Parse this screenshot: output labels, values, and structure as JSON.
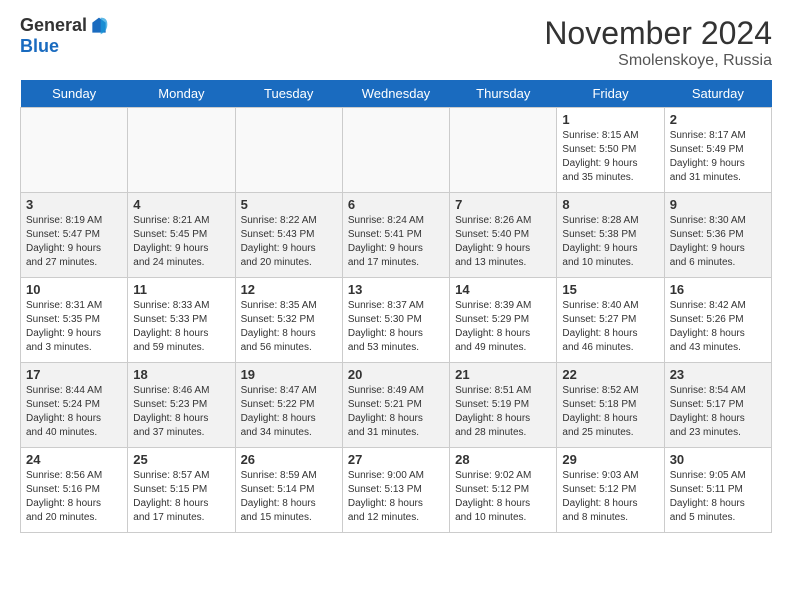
{
  "logo": {
    "general": "General",
    "blue": "Blue"
  },
  "title": "November 2024",
  "location": "Smolenskoye, Russia",
  "days_of_week": [
    "Sunday",
    "Monday",
    "Tuesday",
    "Wednesday",
    "Thursday",
    "Friday",
    "Saturday"
  ],
  "weeks": [
    [
      {
        "day": "",
        "info": ""
      },
      {
        "day": "",
        "info": ""
      },
      {
        "day": "",
        "info": ""
      },
      {
        "day": "",
        "info": ""
      },
      {
        "day": "",
        "info": ""
      },
      {
        "day": "1",
        "info": "Sunrise: 8:15 AM\nSunset: 5:50 PM\nDaylight: 9 hours\nand 35 minutes."
      },
      {
        "day": "2",
        "info": "Sunrise: 8:17 AM\nSunset: 5:49 PM\nDaylight: 9 hours\nand 31 minutes."
      }
    ],
    [
      {
        "day": "3",
        "info": "Sunrise: 8:19 AM\nSunset: 5:47 PM\nDaylight: 9 hours\nand 27 minutes."
      },
      {
        "day": "4",
        "info": "Sunrise: 8:21 AM\nSunset: 5:45 PM\nDaylight: 9 hours\nand 24 minutes."
      },
      {
        "day": "5",
        "info": "Sunrise: 8:22 AM\nSunset: 5:43 PM\nDaylight: 9 hours\nand 20 minutes."
      },
      {
        "day": "6",
        "info": "Sunrise: 8:24 AM\nSunset: 5:41 PM\nDaylight: 9 hours\nand 17 minutes."
      },
      {
        "day": "7",
        "info": "Sunrise: 8:26 AM\nSunset: 5:40 PM\nDaylight: 9 hours\nand 13 minutes."
      },
      {
        "day": "8",
        "info": "Sunrise: 8:28 AM\nSunset: 5:38 PM\nDaylight: 9 hours\nand 10 minutes."
      },
      {
        "day": "9",
        "info": "Sunrise: 8:30 AM\nSunset: 5:36 PM\nDaylight: 9 hours\nand 6 minutes."
      }
    ],
    [
      {
        "day": "10",
        "info": "Sunrise: 8:31 AM\nSunset: 5:35 PM\nDaylight: 9 hours\nand 3 minutes."
      },
      {
        "day": "11",
        "info": "Sunrise: 8:33 AM\nSunset: 5:33 PM\nDaylight: 8 hours\nand 59 minutes."
      },
      {
        "day": "12",
        "info": "Sunrise: 8:35 AM\nSunset: 5:32 PM\nDaylight: 8 hours\nand 56 minutes."
      },
      {
        "day": "13",
        "info": "Sunrise: 8:37 AM\nSunset: 5:30 PM\nDaylight: 8 hours\nand 53 minutes."
      },
      {
        "day": "14",
        "info": "Sunrise: 8:39 AM\nSunset: 5:29 PM\nDaylight: 8 hours\nand 49 minutes."
      },
      {
        "day": "15",
        "info": "Sunrise: 8:40 AM\nSunset: 5:27 PM\nDaylight: 8 hours\nand 46 minutes."
      },
      {
        "day": "16",
        "info": "Sunrise: 8:42 AM\nSunset: 5:26 PM\nDaylight: 8 hours\nand 43 minutes."
      }
    ],
    [
      {
        "day": "17",
        "info": "Sunrise: 8:44 AM\nSunset: 5:24 PM\nDaylight: 8 hours\nand 40 minutes."
      },
      {
        "day": "18",
        "info": "Sunrise: 8:46 AM\nSunset: 5:23 PM\nDaylight: 8 hours\nand 37 minutes."
      },
      {
        "day": "19",
        "info": "Sunrise: 8:47 AM\nSunset: 5:22 PM\nDaylight: 8 hours\nand 34 minutes."
      },
      {
        "day": "20",
        "info": "Sunrise: 8:49 AM\nSunset: 5:21 PM\nDaylight: 8 hours\nand 31 minutes."
      },
      {
        "day": "21",
        "info": "Sunrise: 8:51 AM\nSunset: 5:19 PM\nDaylight: 8 hours\nand 28 minutes."
      },
      {
        "day": "22",
        "info": "Sunrise: 8:52 AM\nSunset: 5:18 PM\nDaylight: 8 hours\nand 25 minutes."
      },
      {
        "day": "23",
        "info": "Sunrise: 8:54 AM\nSunset: 5:17 PM\nDaylight: 8 hours\nand 23 minutes."
      }
    ],
    [
      {
        "day": "24",
        "info": "Sunrise: 8:56 AM\nSunset: 5:16 PM\nDaylight: 8 hours\nand 20 minutes."
      },
      {
        "day": "25",
        "info": "Sunrise: 8:57 AM\nSunset: 5:15 PM\nDaylight: 8 hours\nand 17 minutes."
      },
      {
        "day": "26",
        "info": "Sunrise: 8:59 AM\nSunset: 5:14 PM\nDaylight: 8 hours\nand 15 minutes."
      },
      {
        "day": "27",
        "info": "Sunrise: 9:00 AM\nSunset: 5:13 PM\nDaylight: 8 hours\nand 12 minutes."
      },
      {
        "day": "28",
        "info": "Sunrise: 9:02 AM\nSunset: 5:12 PM\nDaylight: 8 hours\nand 10 minutes."
      },
      {
        "day": "29",
        "info": "Sunrise: 9:03 AM\nSunset: 5:12 PM\nDaylight: 8 hours\nand 8 minutes."
      },
      {
        "day": "30",
        "info": "Sunrise: 9:05 AM\nSunset: 5:11 PM\nDaylight: 8 hours\nand 5 minutes."
      }
    ]
  ]
}
